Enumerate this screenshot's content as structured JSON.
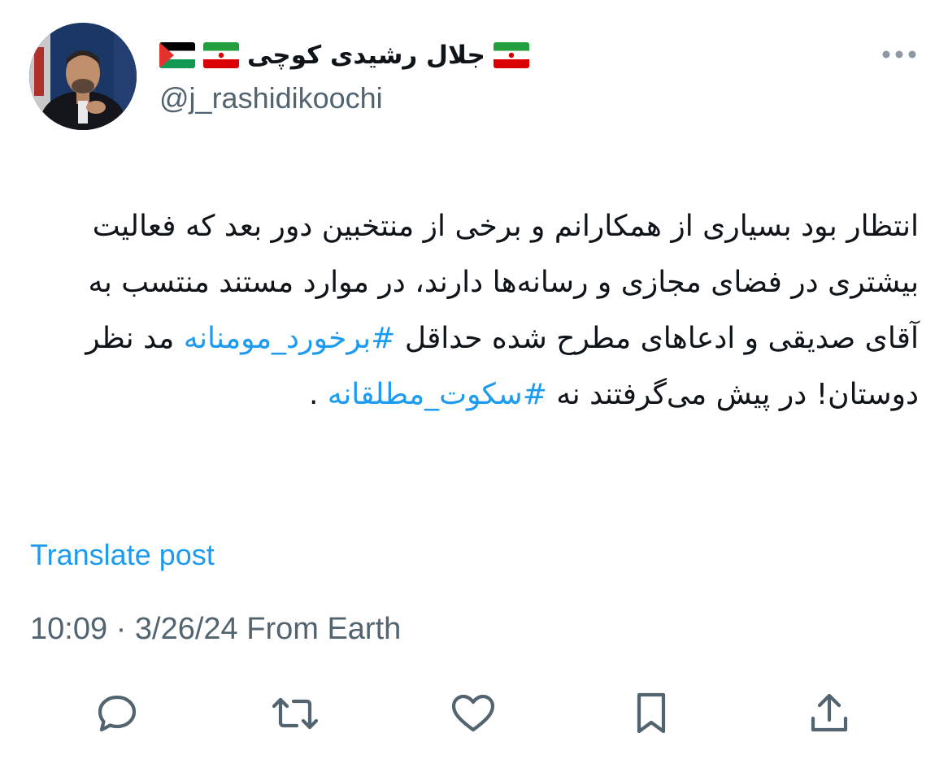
{
  "author": {
    "display_name": "جلال رشیدی کوچی",
    "handle": "@j_rashidikoochi",
    "flags": [
      "palestine-flag",
      "iran-flag",
      "iran-flag"
    ]
  },
  "tweet": {
    "text_before_hashtag1": "انتظار بود بسیاری از همکارانم و برخی از منتخبین دور بعد که فعالیت بیشتری در فضای مجازی و رسانه‌ها دارند، در موارد مستند منتسب به آقای صدیقی و ادعاهای مطرح شده حداقل ",
    "hashtag1": "#برخورد_مومنانه",
    "text_between": " مد نظر دوستان! در پیش می‌گرفتند نه ",
    "hashtag2": "#سکوت_مطلقانه",
    "text_after": " ."
  },
  "translate_label": "Translate post",
  "meta": {
    "time": "10:09",
    "separator": "·",
    "date": "3/26/24",
    "source": "From Earth"
  },
  "actions": [
    "reply-icon",
    "retweet-icon",
    "like-icon",
    "bookmark-icon",
    "share-icon"
  ],
  "colors": {
    "link": "#1d9bf0",
    "text": "#0f1419",
    "secondary": "#536471"
  }
}
